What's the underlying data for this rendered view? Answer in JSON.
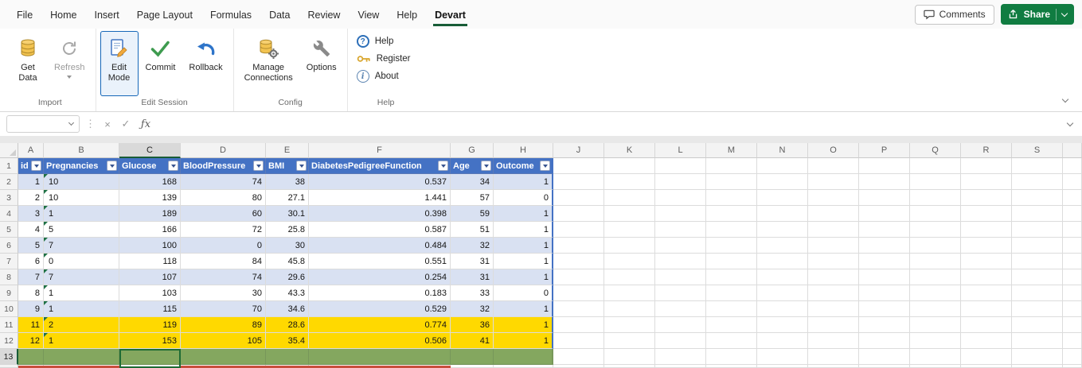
{
  "tabs": {
    "items": [
      {
        "label": "File"
      },
      {
        "label": "Home"
      },
      {
        "label": "Insert"
      },
      {
        "label": "Page Layout"
      },
      {
        "label": "Formulas"
      },
      {
        "label": "Data"
      },
      {
        "label": "Review"
      },
      {
        "label": "View"
      },
      {
        "label": "Help"
      },
      {
        "label": "Devart",
        "active": true
      }
    ]
  },
  "titlebar": {
    "comments_label": "Comments",
    "share_label": "Share"
  },
  "ribbon": {
    "groups": [
      {
        "label": "Import",
        "buttons": [
          {
            "label": "Get Data",
            "line1": "Get",
            "line2": "Data"
          },
          {
            "label": "Refresh",
            "line1": "Refresh",
            "disabled": true,
            "dropdown": true
          }
        ]
      },
      {
        "label": "Edit Session",
        "buttons": [
          {
            "label": "Edit Mode",
            "line1": "Edit",
            "line2": "Mode",
            "active": true
          },
          {
            "label": "Commit",
            "line1": "Commit"
          },
          {
            "label": "Rollback",
            "line1": "Rollback"
          }
        ]
      },
      {
        "label": "Config",
        "buttons": [
          {
            "label": "Manage Connections",
            "line1": "Manage",
            "line2": "Connections"
          },
          {
            "label": "Options",
            "line1": "Options"
          }
        ]
      },
      {
        "label": "Help",
        "buttons": [
          {
            "label": "Help"
          },
          {
            "label": "Register"
          },
          {
            "label": "About"
          }
        ]
      }
    ]
  },
  "glyphs": {
    "question": "?",
    "info": "i",
    "cancel": "×",
    "enter": "✓",
    "fx": "ƒx",
    "dots": "⋮"
  },
  "formula_bar": {
    "name_box_value": "",
    "input_value": ""
  },
  "grid": {
    "column_letters": [
      "A",
      "B",
      "C",
      "D",
      "E",
      "F",
      "G",
      "H",
      "J",
      "K",
      "L",
      "M",
      "N",
      "O",
      "P",
      "Q",
      "R",
      "S"
    ],
    "row_numbers": [
      "1",
      "2",
      "3",
      "4",
      "5",
      "6",
      "7",
      "8",
      "9",
      "10",
      "11",
      "12",
      "13"
    ],
    "selection": {
      "active_cell": "C13",
      "selected_column": "C",
      "selected_row": "13"
    },
    "table": {
      "headers": [
        "id",
        "Pregnancies",
        "Glucose",
        "BloodPressure",
        "BMI",
        "DiabetesPedigreeFunction",
        "Age",
        "Outcome"
      ],
      "text_format_column": "Pregnancies",
      "rows": [
        {
          "r": "2",
          "state": "banded",
          "cells": [
            "1",
            "10",
            "168",
            "74",
            "38",
            "0.537",
            "34",
            "1"
          ]
        },
        {
          "r": "3",
          "state": "plain",
          "cells": [
            "2",
            "10",
            "139",
            "80",
            "27.1",
            "1.441",
            "57",
            "0"
          ]
        },
        {
          "r": "4",
          "state": "banded",
          "cells": [
            "3",
            "1",
            "189",
            "60",
            "30.1",
            "0.398",
            "59",
            "1"
          ]
        },
        {
          "r": "5",
          "state": "plain",
          "cells": [
            "4",
            "5",
            "166",
            "72",
            "25.8",
            "0.587",
            "51",
            "1"
          ]
        },
        {
          "r": "6",
          "state": "banded",
          "cells": [
            "5",
            "7",
            "100",
            "0",
            "30",
            "0.484",
            "32",
            "1"
          ]
        },
        {
          "r": "7",
          "state": "plain",
          "cells": [
            "6",
            "0",
            "118",
            "84",
            "45.8",
            "0.551",
            "31",
            "1"
          ]
        },
        {
          "r": "8",
          "state": "banded",
          "cells": [
            "7",
            "7",
            "107",
            "74",
            "29.6",
            "0.254",
            "31",
            "1"
          ]
        },
        {
          "r": "9",
          "state": "plain",
          "cells": [
            "8",
            "1",
            "103",
            "30",
            "43.3",
            "0.183",
            "33",
            "0"
          ]
        },
        {
          "r": "10",
          "state": "banded",
          "cells": [
            "9",
            "1",
            "115",
            "70",
            "34.6",
            "0.529",
            "32",
            "1"
          ]
        },
        {
          "r": "11",
          "state": "modified",
          "cells": [
            "11",
            "2",
            "119",
            "89",
            "28.6",
            "0.774",
            "36",
            "1"
          ]
        },
        {
          "r": "12",
          "state": "modified",
          "cells": [
            "12",
            "1",
            "153",
            "105",
            "35.4",
            "0.506",
            "41",
            "1"
          ]
        },
        {
          "r": "13",
          "state": "inserted",
          "cells": [
            "",
            "",
            "",
            "",
            "",
            "",
            "",
            ""
          ]
        }
      ]
    }
  },
  "colors": {
    "accent_green": "#185C37",
    "share_green": "#107C41",
    "table_header_blue": "#4472C4",
    "banded_blue": "#D9E1F2",
    "modified_yellow": "#FFD900",
    "inserted_green": "#84A75F",
    "deleted_red": "#C94F3D",
    "active_button_blue": "#1667B8"
  }
}
